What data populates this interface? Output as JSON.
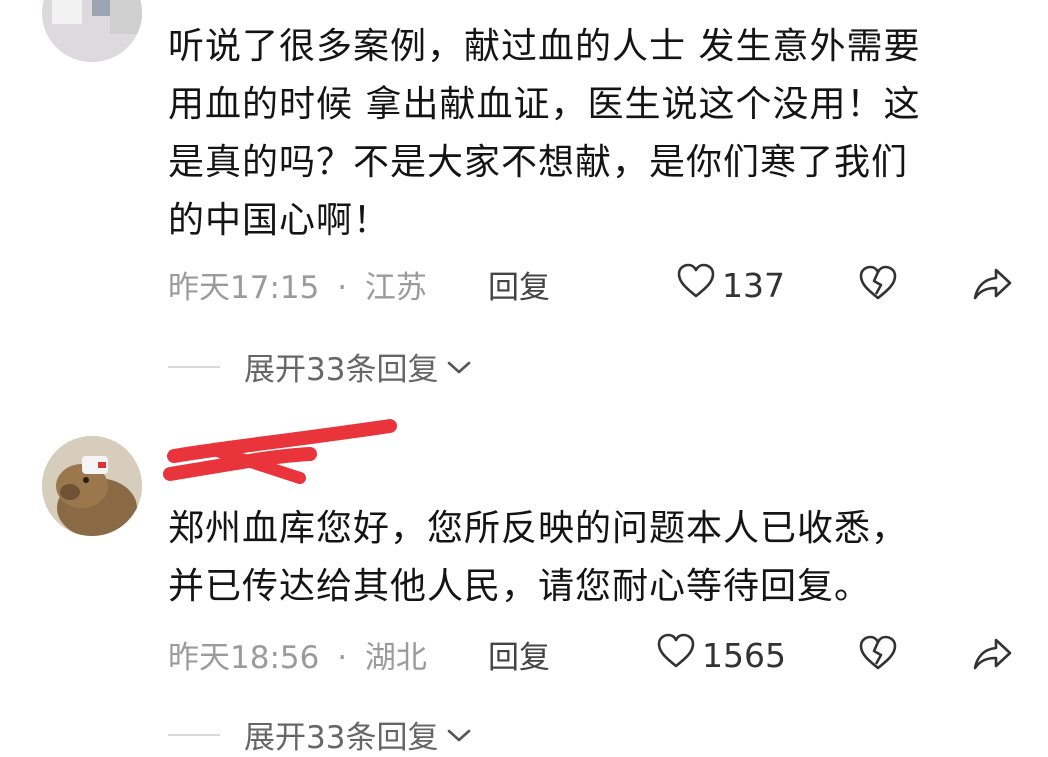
{
  "comments": [
    {
      "text": "听说了很多案例，献过血的人士 发生意外需要\n用血的时候 拿出献血证，医生说这个没用！这\n是真的吗？不是大家不想献，是你们寒了我们\n的中国心啊！",
      "time": "昨天17:15",
      "sep": "·",
      "location": "江苏",
      "reply_label": "回复",
      "likes": "137",
      "expand_label": "展开33条回复"
    },
    {
      "text": "郑州血库您好，您所反映的问题本人已收悉，\n并已传达给其他人民，请您耐心等待回复。",
      "time": "昨天18:56",
      "sep": "·",
      "location": "湖北",
      "reply_label": "回复",
      "likes": "1565",
      "expand_label": "展开33条回复"
    }
  ],
  "icons": {
    "like": "heart-outline-icon",
    "dislike": "broken-heart-icon",
    "share": "share-arrow-icon",
    "expand": "chevron-down-icon"
  },
  "colors": {
    "redaction": "#e8343a",
    "meta": "#9b9b9b"
  }
}
